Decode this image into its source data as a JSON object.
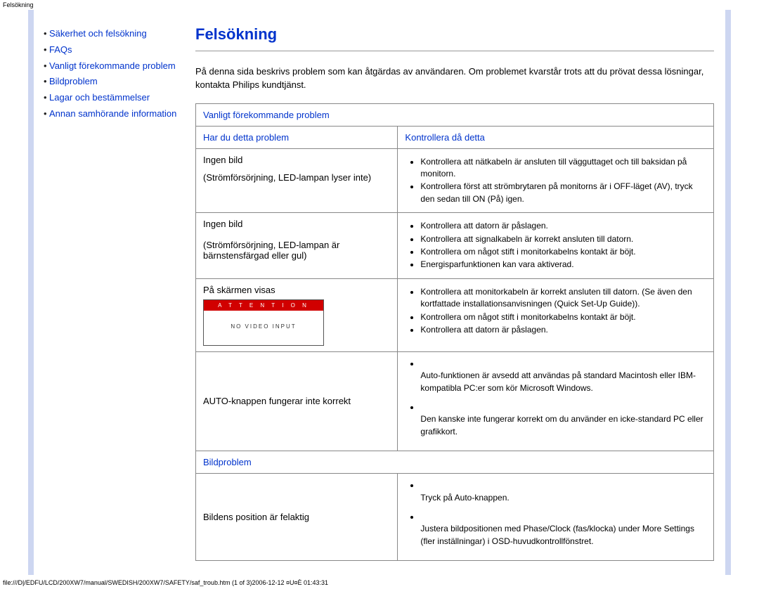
{
  "topline": "Felsökning",
  "sidebar": {
    "items": [
      "Säkerhet och felsökning",
      "FAQs",
      "Vanligt förekommande problem",
      "Bildproblem",
      "Lagar och bestämmelser",
      "Annan samhörande information"
    ]
  },
  "main": {
    "title": "Felsökning",
    "intro": "På denna sida beskrivs problem som kan åtgärdas av användaren. Om problemet kvarstår trots att du prövat dessa lösningar, kontakta Philips kundtjänst.",
    "section1_title": "Vanligt förekommande problem",
    "col_problem": "Har du detta problem",
    "col_check": "Kontrollera då detta",
    "rows": [
      {
        "problem_lines": [
          "Ingen bild",
          "(Strömförsörjning, LED-lampan lyser inte)"
        ],
        "checks": [
          "Kontrollera att nätkabeln är ansluten till vägguttaget och till baksidan på monitorn.",
          "Kontrollera först att strömbrytaren på monitorns är i OFF-läget (AV), tryck den sedan till ON (På) igen."
        ]
      },
      {
        "problem_lines": [
          "Ingen bild",
          "",
          "(Strömförsörjning, LED-lampan är bärnstensfärgad eller gul)"
        ],
        "checks": [
          "Kontrollera att datorn är påslagen.",
          "Kontrollera att signalkabeln är korrekt ansluten till datorn.",
          "Kontrollera om något stift i monitorkabelns kontakt är böjt.",
          "Energisparfunktionen kan vara aktiverad."
        ]
      },
      {
        "problem_intro": "På skärmen visas",
        "attention_title": "A T T E N T I O N",
        "attention_body": "NO  VIDEO  INPUT",
        "checks": [
          "Kontrollera att monitorkabeln är korrekt ansluten till datorn. (Se även den kortfattade installationsanvisningen (Quick Set-Up Guide)).",
          "Kontrollera om något stift i monitorkabelns kontakt är böjt.",
          "Kontrollera att datorn är påslagen."
        ]
      },
      {
        "problem_single": "AUTO-knappen fungerar inte korrekt",
        "checks_open": [
          "Auto-funktionen är avsedd att användas på standard Macintosh eller IBM-kompatibla PC:er som kör Microsoft Windows.",
          "Den kanske inte fungerar korrekt om du använder en icke-standard PC eller grafikkort."
        ]
      }
    ],
    "section2_title": "Bildproblem",
    "rows2": [
      {
        "problem_single": "Bildens position är felaktig",
        "checks_open": [
          "Tryck på Auto-knappen.",
          "Justera bildpositionen med Phase/Clock (fas/klocka) under More Settings (fler inställningar) i OSD-huvudkontrollfönstret."
        ]
      }
    ]
  },
  "footer": "file:///D|/EDFU/LCD/200XW7/manual/SWEDISH/200XW7/SAFETY/saf_troub.htm (1 of 3)2006-12-12 ¤U¤È 01:43:31"
}
